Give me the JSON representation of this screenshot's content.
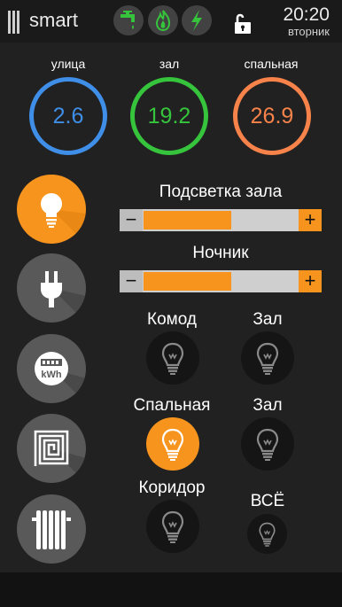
{
  "header": {
    "app_title": "smart",
    "time": "20:20",
    "weekday": "вторник",
    "icons": [
      "menu-icon",
      "water-tap-icon",
      "flame-icon",
      "lightning-icon",
      "unlock-icon"
    ]
  },
  "temperatures": [
    {
      "label": "улица",
      "value": "2.6",
      "color": "#3f8ee8"
    },
    {
      "label": "зал",
      "value": "19.2",
      "color": "#35c43c"
    },
    {
      "label": "спальная",
      "value": "26.9",
      "color": "#f7834a"
    }
  ],
  "sidebar": {
    "items": [
      "lightbulb-icon",
      "plug-icon",
      "electricity-meter-icon",
      "floor-heating-icon",
      "radiator-icon"
    ],
    "meter_text": "kWh"
  },
  "dimmers": [
    {
      "label": "Подсветка зала",
      "level": 0.57,
      "minus": "−",
      "plus": "+"
    },
    {
      "label": "Ночник",
      "level": 0.57,
      "minus": "−",
      "plus": "+"
    }
  ],
  "lamps": [
    {
      "label": "Комод",
      "on": false
    },
    {
      "label": "Зал",
      "on": false
    },
    {
      "label": "Спальная",
      "on": true
    },
    {
      "label": "Зал",
      "on": false
    },
    {
      "label": "Коридор",
      "on": false
    },
    {
      "label": "ВСЁ",
      "on": false
    }
  ],
  "colors": {
    "accent": "#f7941d",
    "background": "#212121",
    "button": "#595959"
  }
}
